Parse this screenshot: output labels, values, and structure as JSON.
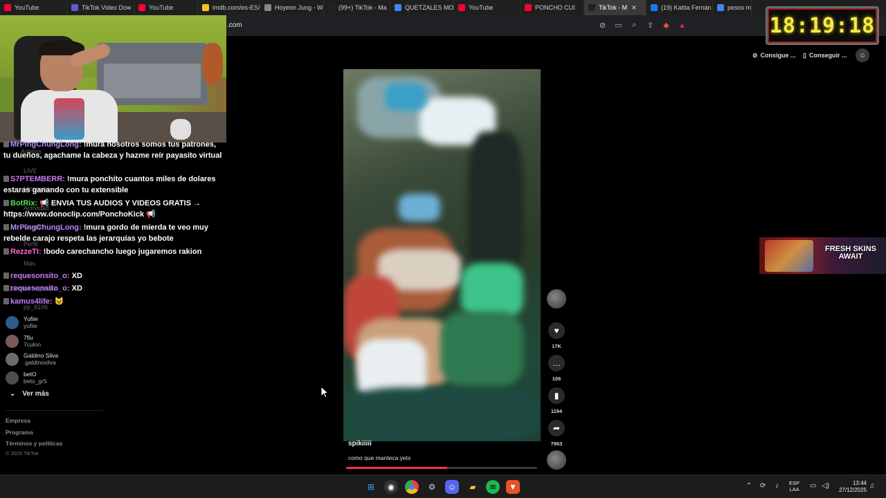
{
  "browser": {
    "tabs": [
      {
        "label": "YouTube",
        "color": "#ff0033"
      },
      {
        "label": "TikTok Video Dow",
        "color": "#5b5bd6"
      },
      {
        "label": "YouTube",
        "color": "#ff0033"
      },
      {
        "label": "imdb.com/es-ES/",
        "color": "#f5c518"
      },
      {
        "label": "Hoyeon Jung - Wi",
        "color": "#888888"
      },
      {
        "label": "(99+) TikTok - Ma",
        "color": "#222222"
      },
      {
        "label": "QUETZALES MON",
        "color": "#4285f4"
      },
      {
        "label": "YouTube",
        "color": "#ff0033"
      },
      {
        "label": "PONCHO CUI",
        "color": "#ff0033"
      },
      {
        "label": "TikTok - M",
        "color": "#222222",
        "active": true
      },
      {
        "label": "(19) Kattia Fernán",
        "color": "#1877f2"
      },
      {
        "label": "pesos mex",
        "color": "#4285f4"
      }
    ],
    "url": ".com",
    "address_icons": [
      "eye-off-icon",
      "cast-icon",
      "zoom-icon",
      "share-icon",
      "brave-shield-icon",
      "rewards-icon"
    ]
  },
  "clock": {
    "time": "18:19:18"
  },
  "top_right": {
    "get_coins_label": "Consigue ...",
    "get_app_label": "Conseguir ..."
  },
  "chat": [
    {
      "user": "MrPingChungLong:",
      "user_color": "#b58cff",
      "text": "!mura nosotros somos tus patrones, tu dueños, agachame la cabeza y hazme reír payasito virtual"
    },
    {
      "user": "S7PTEMBERR:",
      "user_color": "#c77dff",
      "text": "!mura ponchito cuantos miles de dolares estaras ganando con tu extensible"
    },
    {
      "user": "BotRix:",
      "user_color": "#54e346",
      "text": "📢 ENVIA TUS AUDIOS Y VIDEOS GRATIS → https://www.donoclip.com/PonchoKick 📢"
    },
    {
      "user": "MrPingChungLong:",
      "user_color": "#b58cff",
      "text": "!mura gordo de mierda te veo muy rebelde carajo respeta las jerarquías yo bebote"
    },
    {
      "user": "RezzeTI:",
      "user_color": "#ff6bd6",
      "text": "!bodo carechancho luego jugaremos rakion"
    },
    {
      "user": "requesonsito_o:",
      "user_color": "#c77dff",
      "text": "XD"
    },
    {
      "user": "requesonsito_o:",
      "user_color": "#c77dff",
      "text": "XD"
    },
    {
      "user": "kamus4life:",
      "user_color": "#c77dff",
      "text": "😺"
    }
  ],
  "sidebar_ghost": [
    "Amigos",
    "LIVE",
    "Mensajes",
    "Actividad",
    "Cargar",
    "Perfil",
    "Más",
    "Cuentas seguidas",
    "pp_8106"
  ],
  "following": [
    {
      "name": "Yufiie",
      "handle": "yufiie"
    },
    {
      "name": "7fiu",
      "handle": "7culon"
    },
    {
      "name": "Galdino Silva",
      "handle": ".galdinosilva"
    },
    {
      "name": "betO",
      "handle": "beto_gr5"
    }
  ],
  "see_more": "Ver más",
  "footer": {
    "links": [
      "Empresa",
      "Programa",
      "Términos y políticas"
    ],
    "copyright": "© 2025 TikTok"
  },
  "video": {
    "author": "spikiiiii",
    "caption": "como que manteca yets",
    "progress": 0.53,
    "likes": "17K",
    "comments": "106",
    "saves": "1194",
    "shares": "7963"
  },
  "ad": {
    "line1": "FRESH SKINS",
    "line2": "AWAIT"
  },
  "taskbar": {
    "apps": [
      "windows-start-icon",
      "obs-icon",
      "chrome-icon",
      "steam-icon",
      "discord-icon",
      "file-explorer-icon",
      "spotify-icon",
      "brave-icon"
    ],
    "lang_line1": "ESP",
    "lang_line2": "LAA",
    "time": "13:44",
    "date": "27/12/2025"
  },
  "colors": {
    "tiktok_red": "#fe2c55",
    "clock_digits": "#f6e94a",
    "taskbar_bg": "#1c1c1c"
  }
}
